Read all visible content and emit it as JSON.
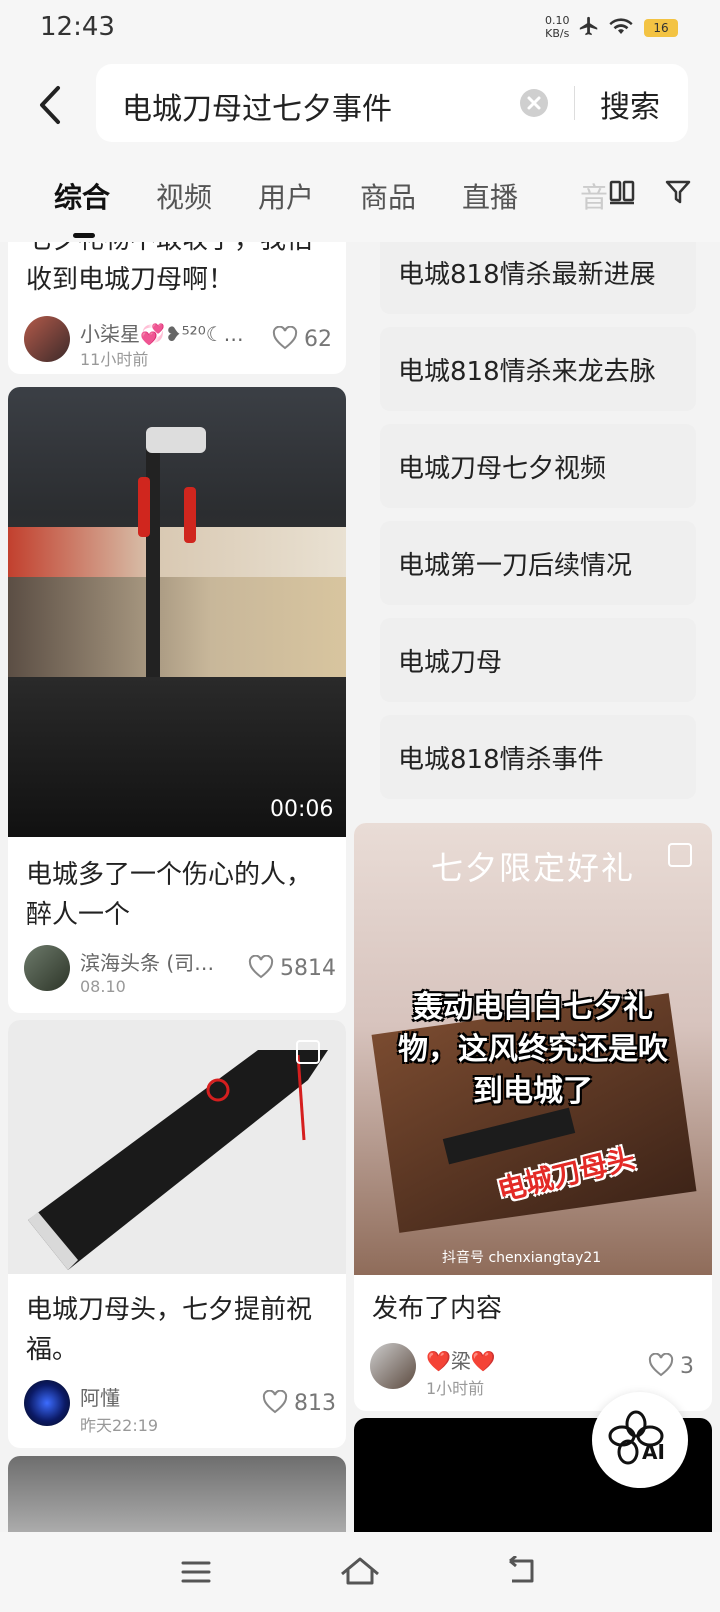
{
  "status": {
    "time": "12:43",
    "net_speed": "0.10",
    "net_unit": "KB/s",
    "battery": "16"
  },
  "search": {
    "query": "电城刀母过七夕事件",
    "button": "搜索"
  },
  "tabs": [
    "综合",
    "视频",
    "用户",
    "商品",
    "直播",
    "音"
  ],
  "cards": {
    "c1": {
      "title_l1": "七夕礼物不敢收了，我怕",
      "title_l2": "收到电城刀母啊！",
      "author": "小柒星💞❥⁵²⁰☾…",
      "time": "11小时前",
      "likes": "62"
    },
    "c2": {
      "duration": "00:06",
      "title_l1": "电城多了一个伤心的人，",
      "title_l2": "醉人一个",
      "author": "滨海头条 (司…",
      "time": "08.10",
      "likes": "5814"
    },
    "c3": {
      "title_l1": "电城刀母头，七夕提前祝",
      "title_l2": "福。",
      "author": "阿懂",
      "time": "昨天22:19",
      "likes": "813"
    },
    "c4": {
      "overlay_top": "七夕限定好礼",
      "overlay_l1": "轰动电白白七夕礼",
      "overlay_l2": "物，这风终究还是吹",
      "overlay_l3": "到电城了",
      "overlay_red": "电城刀母头",
      "watermark": "抖音号 chenxiangtay21",
      "title": "发布了内容",
      "author": "❤️梁❤️",
      "time": "1小时前",
      "likes": "3"
    }
  },
  "suggestions": [
    "电城818情杀最新进展",
    "电城818情杀来龙去脉",
    "电城刀母七夕视频",
    "电城第一刀后续情况",
    "电城刀母",
    "电城818情杀事件"
  ],
  "fab": {
    "label": "AI"
  },
  "colors": {
    "accent_red": "#e23b2e",
    "bg": "#f3f3f3"
  }
}
